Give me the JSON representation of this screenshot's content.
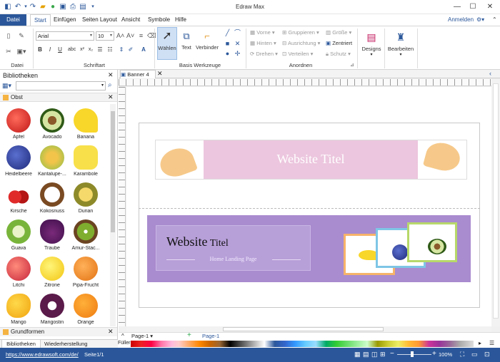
{
  "app": {
    "title": "Edraw Max",
    "login": "Anmelden"
  },
  "quick_access": [
    "app-logo-icon",
    "undo-icon",
    "undo-dropdown-icon",
    "redo-icon",
    "open-folder-icon",
    "export-icon",
    "save-icon",
    "print-icon",
    "publish-icon",
    "more-icon"
  ],
  "menu": {
    "datei": "Datei",
    "tabs": [
      "Start",
      "Einfügen",
      "Seiten Layout",
      "Ansicht",
      "Symbole",
      "Hilfe"
    ]
  },
  "ribbon": {
    "font": {
      "name": "Arial",
      "size": "10"
    },
    "groups": {
      "datei": "Datei",
      "schriftart": "Schriftart",
      "werkzeuge": "Basis Werkzeuge",
      "anordnen": "Anordnen"
    },
    "tools": {
      "select": "Wählen",
      "text": "Text",
      "connector": "Verbinder"
    },
    "arrange": {
      "front": "Vorne",
      "back": "Hinten",
      "rotate": "Drehen",
      "group": "Gruppieren",
      "align": "Ausrichtung",
      "distribute": "Verteilen",
      "size": "Größe",
      "center": "Zentriert",
      "protect": "Schutz"
    },
    "designs": "Designs",
    "edit": "Bearbeiten"
  },
  "library": {
    "title": "Bibliotheken",
    "category": "Obst",
    "items": [
      "Apfel",
      "Avocado",
      "Banana",
      "Heidelbeere",
      "Kantalupe-...",
      "Karambole",
      "Kirsche",
      "Kokosnuss",
      "Durian",
      "Guava",
      "Traube",
      "Amur-Stac...",
      "Litchi",
      "Zitrone",
      "Pipa-Frucht",
      "Mango",
      "Mangostin",
      "Orange"
    ],
    "section2": "Grundformen",
    "tabs": [
      "Bibliotheken",
      "Wiederherstellung"
    ]
  },
  "doc_tab": "Banner 4",
  "banner1": {
    "title": "Website Titel"
  },
  "banner2": {
    "title_bold": "Website",
    "title_rest": " Titel",
    "subtitle": "Home Landing Page"
  },
  "pages": {
    "page_tab": "Page-1",
    "page_tab2": "Page-1"
  },
  "fill_label": "Füller",
  "status": {
    "url": "https://www.edrawsoft.com/de/",
    "page": "Seite1/1",
    "zoom": "100%"
  },
  "colors": {
    "accent": "#2b579a",
    "banner_pink": "#ecc6de",
    "banner_purple": "#a98bcf",
    "ginkgo": "#f6c98a"
  }
}
